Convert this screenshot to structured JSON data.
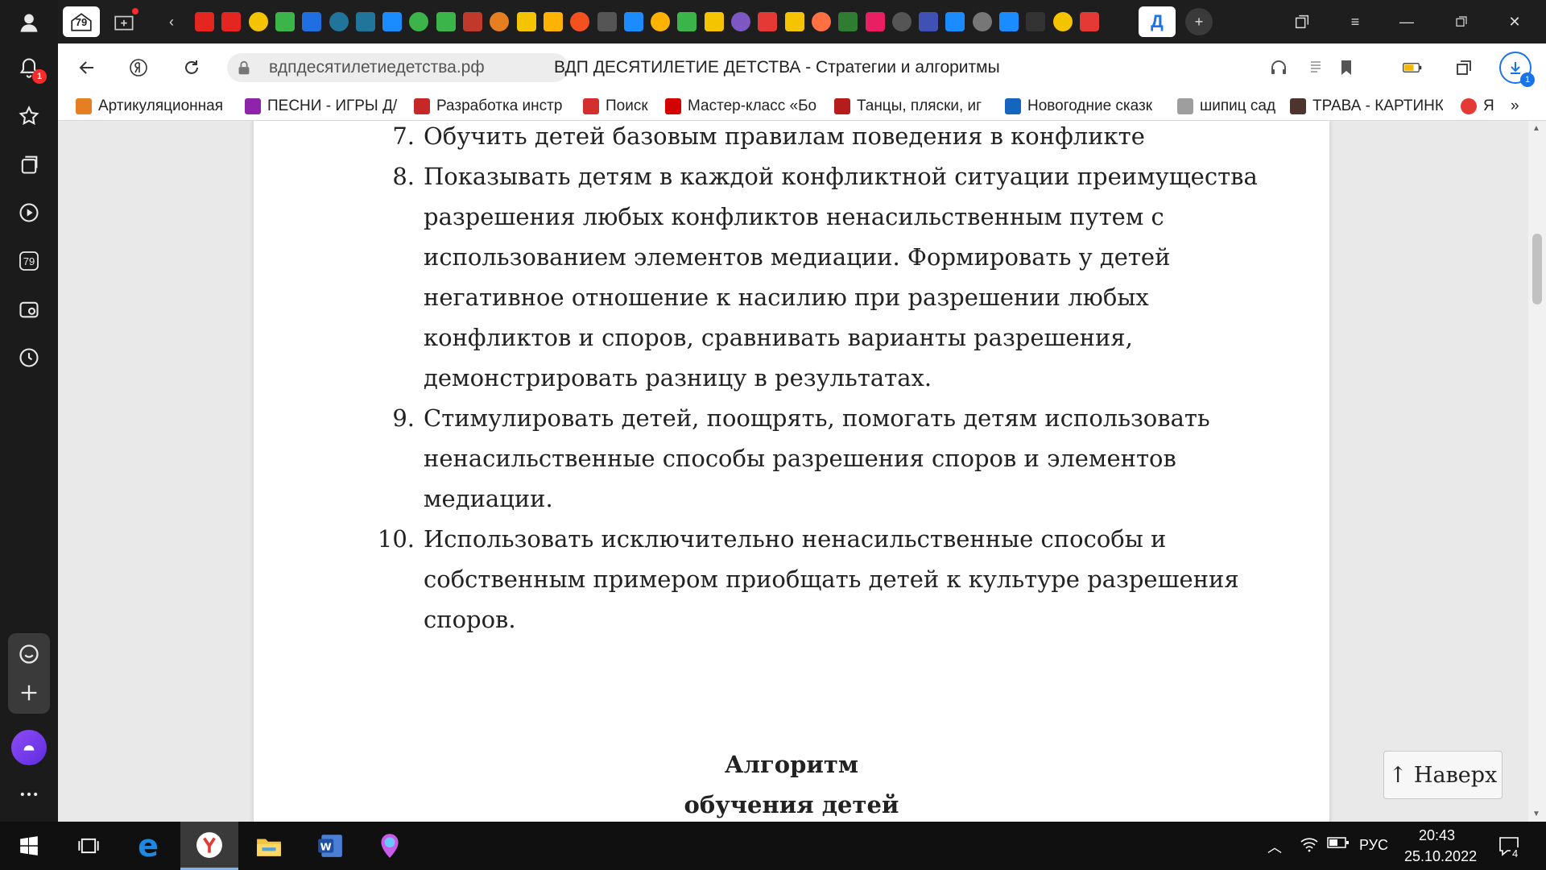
{
  "sidebar": {
    "notification_badge": "1",
    "tabs_count": "79"
  },
  "tabbar": {
    "pinned_count": "79",
    "active_tab_label": "Д",
    "favicon_colors": [
      "#e52620",
      "#e52620",
      "#f5c400",
      "#3bb54a",
      "#1f6fe0",
      "#21759b",
      "#21759b",
      "#1a8cff",
      "#3bb54a",
      "#3bb54a",
      "#c0392b",
      "#e67e22",
      "#f5c400",
      "#ffb300",
      "#f4511e",
      "#555555",
      "#1a8cff",
      "#ffb300",
      "#3bb54a",
      "#f5c400",
      "#7e57c2",
      "#e53935",
      "#f5c400",
      "#ff7043",
      "#2e7d32",
      "#e91e63",
      "#555555",
      "#3f51b5",
      "#1a8cff",
      "#777777",
      "#1a8cff",
      "#333333",
      "#f5c400",
      "#e53935"
    ]
  },
  "addressbar": {
    "url": "вдпдесятилетиедетства.рф",
    "title": "ВДП ДЕСЯТИЛЕТИЕ ДЕТСТВА - Стратегии и алгоритмы",
    "downloads_badge": "1"
  },
  "bookmarks": [
    {
      "label": "Артикуляционная",
      "color": "#e67e22"
    },
    {
      "label": "ПЕСНИ - ИГРЫ Д/",
      "color": "#8e24aa"
    },
    {
      "label": "Разработка инстр",
      "color": "#c62828"
    },
    {
      "label": "Поиск",
      "color": "#d32f2f"
    },
    {
      "label": "Мастер-класс «Бо",
      "color": "#d50000"
    },
    {
      "label": "Танцы, пляски, иг",
      "color": "#b71c1c"
    },
    {
      "label": "Новогодние сказк",
      "color": "#1565c0"
    },
    {
      "label": "шипиц сад",
      "color": "#9e9e9e"
    },
    {
      "label": "ТРАВА - КАРТИНК",
      "color": "#4e342e"
    },
    {
      "label": "Я",
      "color": "#e53935"
    }
  ],
  "bookmarks_more": "»",
  "content": {
    "items": [
      {
        "num": "7.",
        "lines": [
          "Обучить детей базовым правилам поведения в конфликте"
        ]
      },
      {
        "num": "8.",
        "lines": [
          "Показывать детям в каждой конфликтной ситуации преимущества",
          "разрешения любых конфликтов ненасильственным путем с",
          "использованием элементов медиации. Формировать у детей",
          "негативное отношение к насилию при разрешении любых",
          "конфликтов и споров, сравнивать варианты разрешения,",
          "демонстрировать разницу в результатах."
        ]
      },
      {
        "num": "9.",
        "lines": [
          "Стимулировать детей, поощрять, помогать детям использовать",
          "ненасильственные способы разрешения споров и элементов",
          "медиации."
        ]
      },
      {
        "num": "10.",
        "lines": [
          "Использовать исключительно ненасильственные способы и",
          "собственным примером приобщать детей к культуре разрешения",
          "споров."
        ]
      }
    ],
    "heading_line1": "Алгоритм",
    "heading_line2": "обучения детей"
  },
  "to_top_button": "↑ Наверх",
  "taskbar": {
    "language": "РУС",
    "time": "20:43",
    "date": "25.10.2022",
    "notifications_count": "4"
  }
}
